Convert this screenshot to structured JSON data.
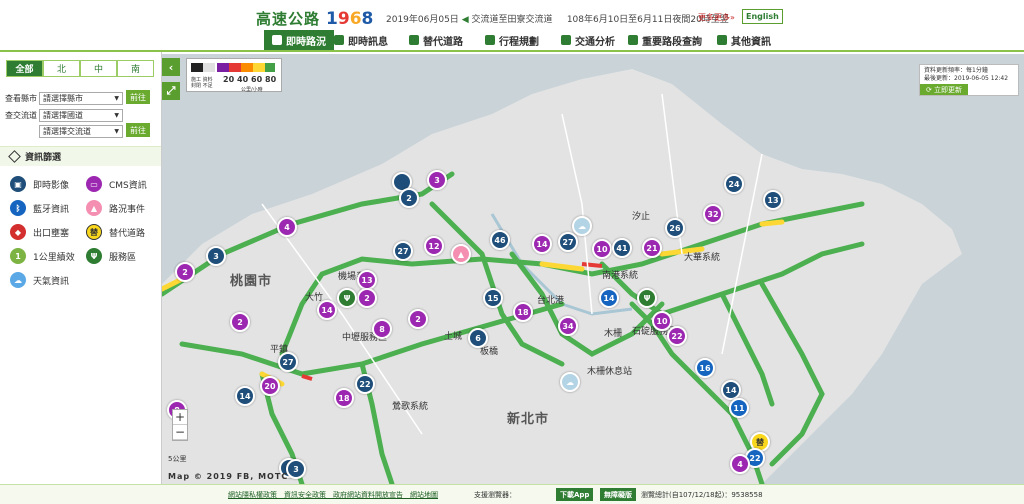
{
  "header": {
    "logo_text": "高速公路",
    "logo_num": [
      "1",
      "9",
      "6",
      "8"
    ],
    "ticker_date": "2019年06月05日",
    "ticker_text": "交流道至田寮交流道",
    "ticker_text2": "108年6月10日至6月11日夜間20時至翌",
    "more_link": "更多更多»",
    "english_button": "English"
  },
  "nav": {
    "items": [
      {
        "label": "即時路況",
        "active": true
      },
      {
        "label": "即時訊息"
      },
      {
        "label": "替代道路"
      },
      {
        "label": "行程規劃"
      },
      {
        "label": "交通分析"
      },
      {
        "label": "重要路段查詢"
      },
      {
        "label": "其他資訊"
      }
    ]
  },
  "sidebar": {
    "region_tabs": [
      "全部",
      "北",
      "中",
      "南"
    ],
    "view_county_label": "查看縣市",
    "county_select": "請選擇縣市",
    "go_button": "前往",
    "interchange_label": "查交流道",
    "highway_select": "請選擇國道",
    "interchange_select": "請選擇交流道",
    "go_button2": "前往",
    "layer_header": "資訊篩選",
    "legend": [
      {
        "label": "即時影像",
        "color": "#1e4e79"
      },
      {
        "label": "CMS資訊",
        "color": "#9c27b0"
      },
      {
        "label": "藍牙資訊",
        "color": "#1565c0"
      },
      {
        "label": "路況事件",
        "color": "#f48fb1"
      },
      {
        "label": "出口壅塞",
        "color": "#d32f2f"
      },
      {
        "label": "替代道路",
        "color": "#f9d71c"
      },
      {
        "label": "1公里績效",
        "color": "#7cb342"
      },
      {
        "label": "服務區",
        "color": "#2e7d32"
      },
      {
        "label": "天氣資訊",
        "color": "#5aa9e6"
      }
    ]
  },
  "map": {
    "speed_legend": {
      "numbers": [
        "20",
        "40",
        "60",
        "80"
      ],
      "tiny1": "施工 資料",
      "tiny2": "封閉 不足",
      "unit": "公里/小時",
      "colors": [
        "#222222",
        "#e0e0e0",
        "#7b1fa2",
        "#e53935",
        "#fb8c00",
        "#fdd835",
        "#43a047"
      ]
    },
    "update_line1": "資料更新頻率：每1分鐘",
    "update_line2": "最後更新：2019-06-05 12:42",
    "refresh_button": "立即更新",
    "cities": [
      "桃園市",
      "新北市"
    ],
    "labels": [
      "大華系統",
      "汐止",
      "鶯歌系統",
      "木柵",
      "石碇服務區",
      "南港系統",
      "機場系統",
      "中壢服務區",
      "平鎮",
      "大竹",
      "木柵休息站",
      "台北港",
      "土城",
      "板橋"
    ],
    "zoom_in": "+",
    "zoom_out": "−",
    "scale_label": "5公里",
    "attribution": "Map © 2019 FB, MOTC",
    "markers": [
      {
        "type": "cam",
        "text": ""
      },
      {
        "type": "cms",
        "text": "3"
      },
      {
        "type": "cam",
        "text": "2"
      },
      {
        "type": "cms",
        "text": "4"
      },
      {
        "type": "cam",
        "text": "3"
      },
      {
        "type": "cms",
        "text": "2"
      },
      {
        "type": "cms",
        "text": "2"
      },
      {
        "type": "cms",
        "text": "12"
      },
      {
        "type": "warn",
        "text": ""
      },
      {
        "type": "cam",
        "text": "46"
      },
      {
        "type": "cms",
        "text": "14"
      },
      {
        "type": "cam",
        "text": "27"
      },
      {
        "type": "cms",
        "text": "10"
      },
      {
        "type": "cam",
        "text": "41"
      },
      {
        "type": "cms",
        "text": "21"
      },
      {
        "type": "cam",
        "text": "26"
      },
      {
        "type": "cam",
        "text": "24"
      },
      {
        "type": "cms",
        "text": "32"
      },
      {
        "type": "cam",
        "text": "13"
      },
      {
        "type": "cms",
        "text": "13"
      },
      {
        "type": "cms",
        "text": "2"
      },
      {
        "type": "cam",
        "text": "15"
      },
      {
        "type": "cms",
        "text": "18"
      },
      {
        "type": "cms",
        "text": "34"
      },
      {
        "type": "svc",
        "text": ""
      },
      {
        "type": "bt",
        "text": "14"
      },
      {
        "type": "cms",
        "text": "10"
      },
      {
        "type": "cms",
        "text": "22"
      },
      {
        "type": "cms",
        "text": "8"
      },
      {
        "type": "cam",
        "text": "6"
      },
      {
        "type": "cms",
        "text": "14"
      },
      {
        "type": "cam",
        "text": "27"
      },
      {
        "type": "cms",
        "text": "20"
      },
      {
        "type": "cam",
        "text": "22"
      },
      {
        "type": "cms",
        "text": "18"
      },
      {
        "type": "cam",
        "text": "14"
      },
      {
        "type": "bt",
        "text": "16"
      },
      {
        "type": "cam",
        "text": "14"
      },
      {
        "type": "bt",
        "text": "11"
      },
      {
        "type": "cms",
        "text": "8"
      },
      {
        "type": "cam",
        "text": "2"
      },
      {
        "type": "cam",
        "text": "3"
      },
      {
        "type": "alt",
        "text": "替"
      },
      {
        "type": "bt",
        "text": "22"
      },
      {
        "type": "cms",
        "text": "4"
      },
      {
        "type": "svc",
        "text": ""
      },
      {
        "type": "wx",
        "text": ""
      },
      {
        "type": "wx",
        "text": ""
      },
      {
        "type": "cms",
        "text": "2"
      },
      {
        "type": "cam",
        "text": "27"
      }
    ]
  },
  "footer": {
    "links": "網站隱私權政策　資訊安全政策　政府網站資料開放宣告　網站地圖",
    "support": "支援瀏覽器：",
    "app_button": "下載App",
    "nobarrier_button": "無障礙版",
    "visit_count": "瀏覽總計(自107/12/18起)：9538558"
  }
}
